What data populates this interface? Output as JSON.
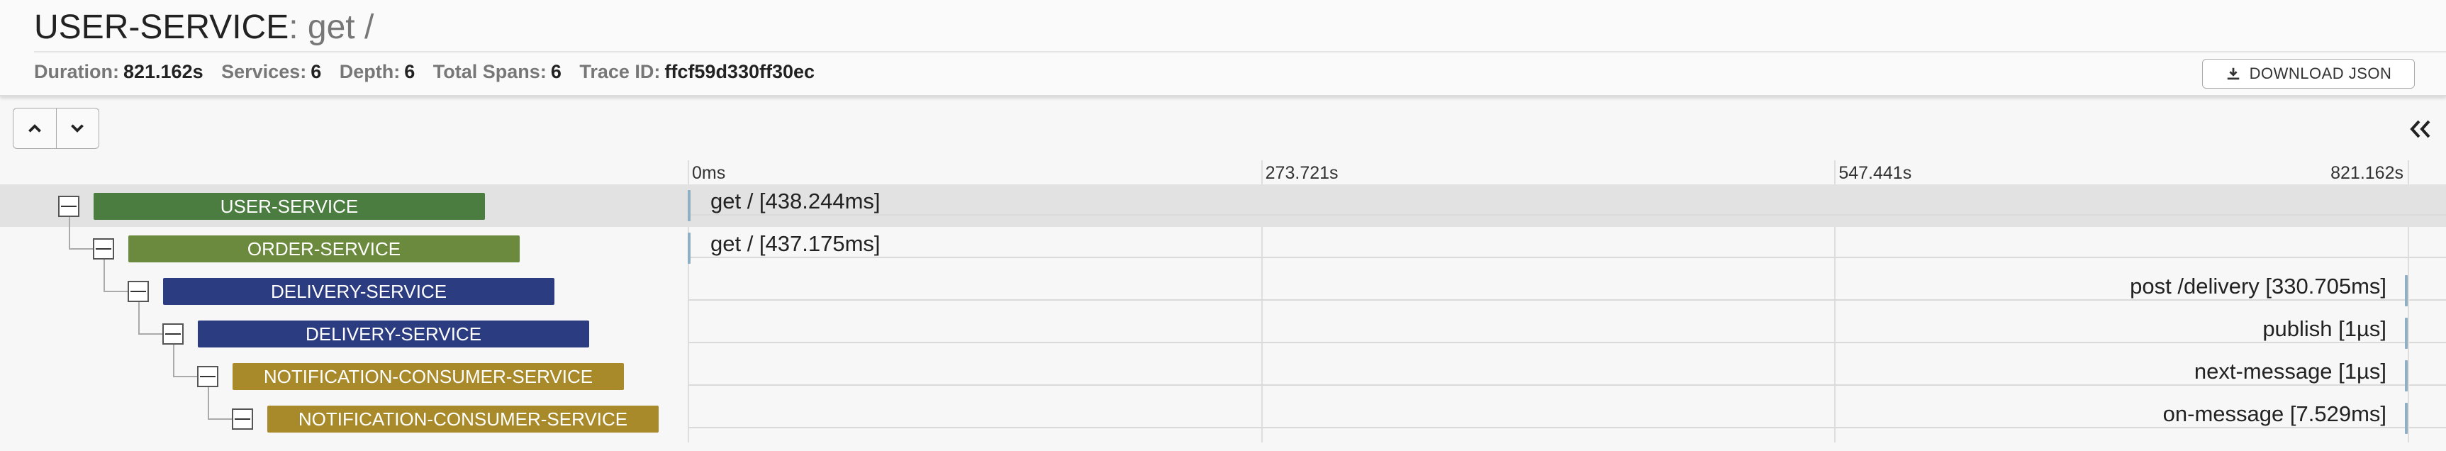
{
  "header": {
    "service_name": "USER-SERVICE",
    "operation": ": get /",
    "duration_label": "Duration:",
    "duration_value": "821.162s",
    "services_label": "Services:",
    "services_value": "6",
    "depth_label": "Depth:",
    "depth_value": "6",
    "total_spans_label": "Total Spans:",
    "total_spans_value": "6",
    "trace_id_label": "Trace ID:",
    "trace_id_value": "ffcf59d330ff30ec",
    "download_label": "DOWNLOAD JSON"
  },
  "toolbar": {
    "icons": [
      "chevron-up-icon",
      "chevron-down-icon",
      "double-chevron-left-icon"
    ]
  },
  "timeline": {
    "ticks": [
      "0ms",
      "273.721s",
      "547.441s",
      "821.162s"
    ]
  },
  "spans": [
    {
      "service": "USER-SERVICE",
      "label": "get / [438.244ms]",
      "depth": 0,
      "color": "#4a7d3f",
      "start_fraction": 0.0,
      "highlighted": true
    },
    {
      "service": "ORDER-SERVICE",
      "label": "get / [437.175ms]",
      "depth": 1,
      "color": "#6b8a3e",
      "start_fraction": 0.0,
      "highlighted": false
    },
    {
      "service": "DELIVERY-SERVICE",
      "label": "post /delivery [330.705ms]",
      "depth": 2,
      "color": "#2c3c80",
      "start_fraction": 1.0,
      "highlighted": false
    },
    {
      "service": "DELIVERY-SERVICE",
      "label": "publish [1µs]",
      "depth": 3,
      "color": "#2c3c80",
      "start_fraction": 1.0,
      "highlighted": false
    },
    {
      "service": "NOTIFICATION-CONSUMER-SERVICE",
      "label": "next-message [1µs]",
      "depth": 4,
      "color": "#a88a2b",
      "start_fraction": 1.0,
      "highlighted": false
    },
    {
      "service": "NOTIFICATION-CONSUMER-SERVICE",
      "label": "on-message [7.529ms]",
      "depth": 5,
      "color": "#a88a2b",
      "start_fraction": 1.0,
      "highlighted": false
    }
  ]
}
